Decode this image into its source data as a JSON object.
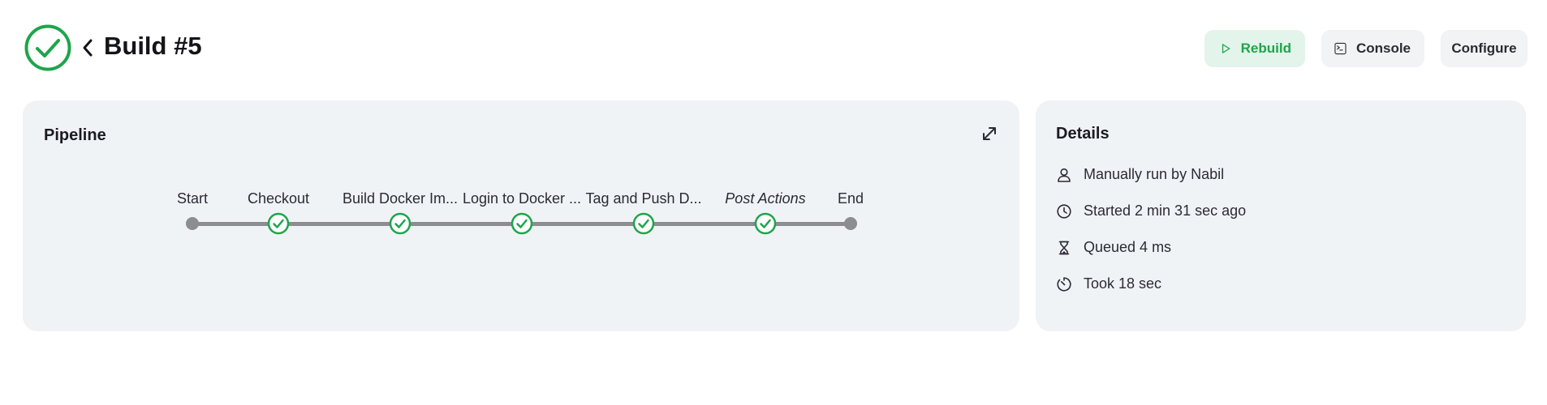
{
  "header": {
    "title": "Build #5",
    "status": "success",
    "status_color": "#1ea54b"
  },
  "toolbar": {
    "rebuild_label": "Rebuild",
    "console_label": "Console",
    "configure_label": "Configure"
  },
  "pipeline": {
    "title": "Pipeline",
    "stages": [
      {
        "label": "Start",
        "status": "endpoint"
      },
      {
        "label": "Checkout",
        "status": "success"
      },
      {
        "label": "Build Docker Im...",
        "status": "success"
      },
      {
        "label": "Login to Docker ...",
        "status": "success"
      },
      {
        "label": "Tag and Push D...",
        "status": "success"
      },
      {
        "label": "Post Actions",
        "status": "success"
      },
      {
        "label": "End",
        "status": "endpoint"
      }
    ]
  },
  "details": {
    "title": "Details",
    "rows": [
      {
        "icon": "user-icon",
        "text": "Manually run by Nabil"
      },
      {
        "icon": "clock-icon",
        "text": "Started 2 min 31 sec ago"
      },
      {
        "icon": "hourglass-icon",
        "text": "Queued 4 ms"
      },
      {
        "icon": "timer-icon",
        "text": "Took 18 sec"
      }
    ]
  }
}
